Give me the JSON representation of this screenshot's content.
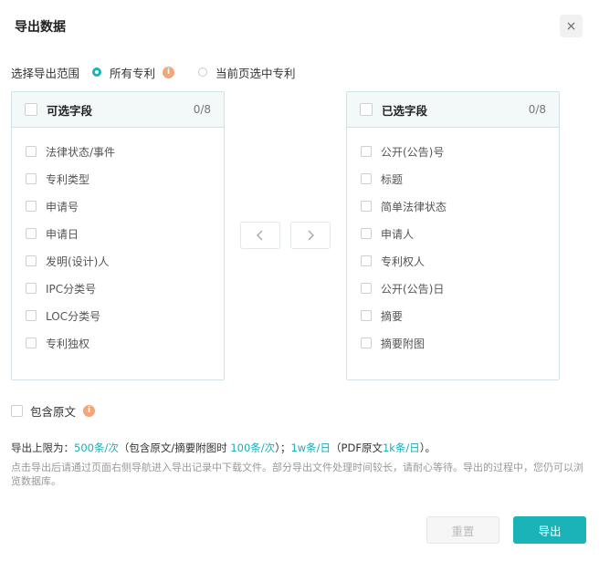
{
  "dialog": {
    "title": "导出数据",
    "close_glyph": "×"
  },
  "scope": {
    "label": "选择导出范围",
    "options": [
      {
        "label": "所有专利",
        "selected": true,
        "info_glyph": "i"
      },
      {
        "label": "当前页选中专利",
        "selected": false
      }
    ]
  },
  "available": {
    "title": "可选字段",
    "count": "0/8",
    "items": [
      "法律状态/事件",
      "专利类型",
      "申请号",
      "申请日",
      "发明(设计)人",
      "IPC分类号",
      "LOC分类号",
      "专利独权"
    ]
  },
  "selected": {
    "title": "已选字段",
    "count": "0/8",
    "items": [
      "公开(公告)号",
      "标题",
      "简单法律状态",
      "申请人",
      "专利权人",
      "公开(公告)日",
      "摘要",
      "摘要附图"
    ]
  },
  "transfer": {
    "left_icon": "chevron-left-icon",
    "right_icon": "chevron-right-icon"
  },
  "include_original": {
    "label": "包含原文",
    "checked": false,
    "info_glyph": "i"
  },
  "limits": {
    "prefix": "导出上限为：",
    "per_time": "500条/次",
    "mid1": "（包含原文/摘要附图时 ",
    "per_time_with_original": "100条/次",
    "mid2": "）；",
    "per_day": "1w条/日",
    "mid3": "（PDF原文",
    "pdf_per_day": "1k条/日",
    "suffix": "）。"
  },
  "notice": "点击导出后请通过页面右侧导航进入导出记录中下载文件。部分导出文件处理时间较长，请耐心等待。导出的过程中，您仍可以浏览数据库。",
  "buttons": {
    "reset": "重置",
    "export": "导出"
  },
  "colors": {
    "accent": "#1ab3b8",
    "info": "#f2a67a"
  }
}
